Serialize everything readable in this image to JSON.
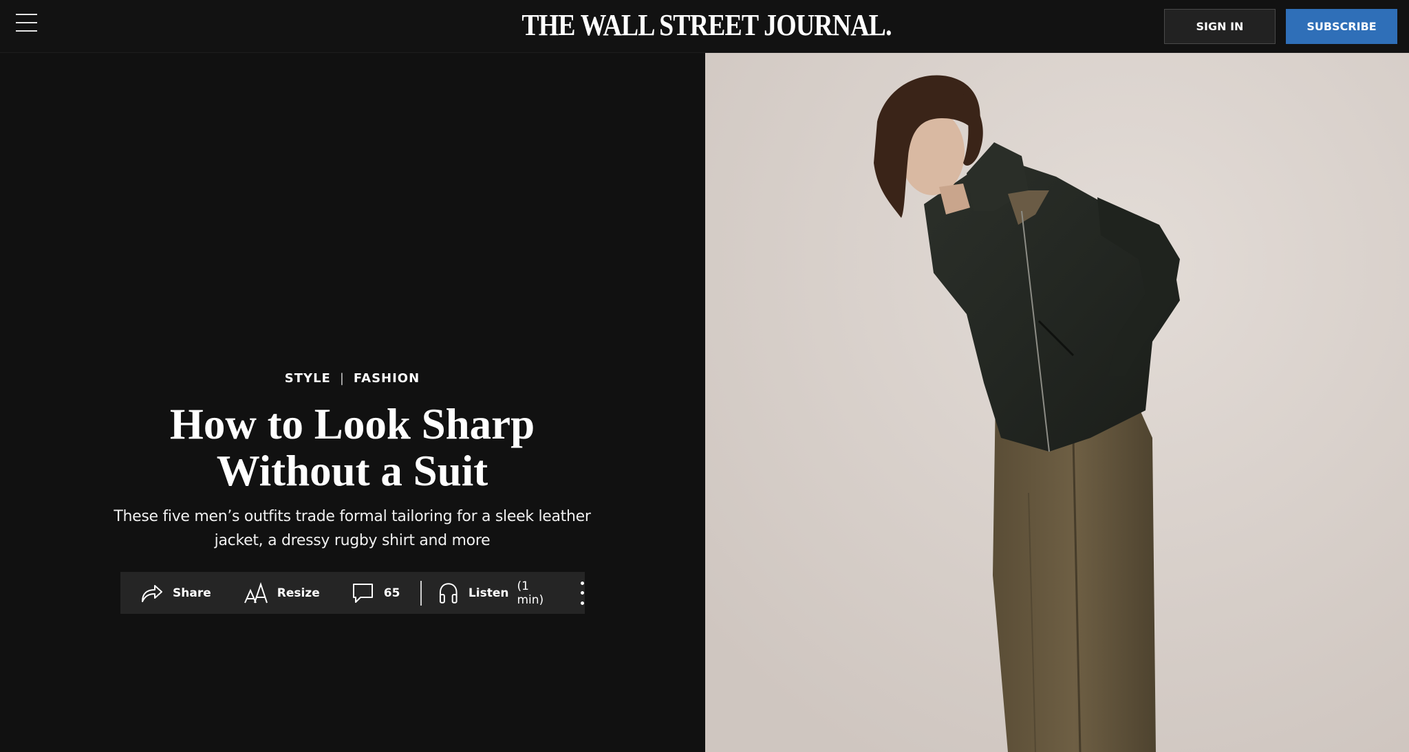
{
  "header": {
    "logo": "THE WALL STREET JOURNAL.",
    "sign_in": "SIGN IN",
    "subscribe": "SUBSCRIBE",
    "icons": {
      "menu": "hamburger-menu-icon"
    }
  },
  "article": {
    "section": "STYLE",
    "subsection": "FASHION",
    "headline": "How to Look Sharp Without a Suit",
    "dek": "These five men’s outfits trade formal tailoring for a sleek leather jacket, a dressy rugby shirt and more"
  },
  "tools": {
    "share": "Share",
    "resize": "Resize",
    "comments_count": "65",
    "listen": "Listen",
    "listen_duration": "(1 min)",
    "icons": {
      "share": "share-arrow-icon",
      "resize": "resize-text-icon",
      "comments": "comment-bubble-icon",
      "listen": "headphones-icon",
      "more": "more-vertical-icon"
    }
  },
  "colors": {
    "page_background": "#111111",
    "header_background": "#121212",
    "subscribe_button": "#2f6fb8",
    "sign_in_button": "#222222",
    "tools_bar": "#252525",
    "photo_background": "#d9d3ce"
  }
}
